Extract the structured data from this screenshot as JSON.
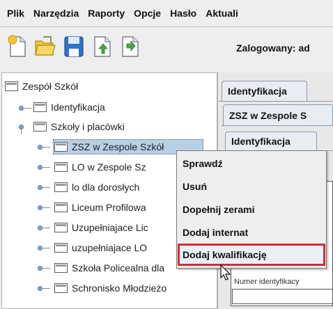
{
  "menubar": {
    "items": [
      "Plik",
      "Narzędzia",
      "Raporty",
      "Opcje",
      "Hasło",
      "Aktuali"
    ]
  },
  "toolbar": {
    "icons": [
      "new-document-icon",
      "open-folder-icon",
      "save-icon",
      "export-document-icon",
      "import-document-icon"
    ],
    "logged_label": "Zalogowany: ad"
  },
  "tree": {
    "root": "Zespół Szkół",
    "items": [
      "Identyfikacja",
      "Szkoły i placówki",
      "ZSZ w Zespole Szkół",
      "LO w Zespole Sz",
      "lo dla dorosłych",
      "Liceum Profilowa",
      "Uzupełniajace Lic",
      "uzupełniajace LO",
      "Szkoła Policealna dla",
      "Schronisko Młodzieżo"
    ]
  },
  "right_panel": {
    "tab_main": "Identyfikacja",
    "tab_school": "ZSZ w Zespole S",
    "tab_sub": "Identyfikacja",
    "field_label": "Numer identyfikacy"
  },
  "context_menu": {
    "items": [
      "Sprawdź",
      "Usuń",
      "Dopełnij zerami",
      "Dodaj internat",
      "Dodaj kwalifikację"
    ]
  },
  "colors": {
    "highlight_border": "#d62b36",
    "selection": "#b8cfe5"
  }
}
